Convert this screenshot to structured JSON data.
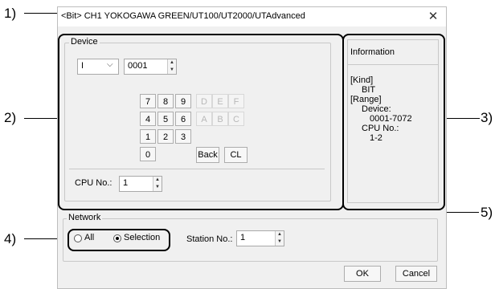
{
  "callouts": [
    "1)",
    "2)",
    "3)",
    "4)",
    "5)"
  ],
  "dialog": {
    "title": "<Bit> CH1 YOKOGAWA GREEN/UT100/UT2000/UTAdvanced",
    "close_glyph": "✕"
  },
  "device": {
    "group_label": "Device",
    "type_selected": "I",
    "number_value": "0001",
    "keypad": [
      {
        "label": "7",
        "enabled": true
      },
      {
        "label": "8",
        "enabled": true
      },
      {
        "label": "9",
        "enabled": true
      },
      {
        "label": "D",
        "enabled": false
      },
      {
        "label": "E",
        "enabled": false
      },
      {
        "label": "F",
        "enabled": false
      },
      {
        "label": "4",
        "enabled": true
      },
      {
        "label": "5",
        "enabled": true
      },
      {
        "label": "6",
        "enabled": true
      },
      {
        "label": "A",
        "enabled": false
      },
      {
        "label": "B",
        "enabled": false
      },
      {
        "label": "C",
        "enabled": false
      },
      {
        "label": "1",
        "enabled": true
      },
      {
        "label": "2",
        "enabled": true
      },
      {
        "label": "3",
        "enabled": true
      },
      {
        "label": "0",
        "enabled": true
      }
    ],
    "back_label": "Back",
    "clear_label": "CL",
    "cpu_label": "CPU No.:",
    "cpu_value": "1"
  },
  "information": {
    "header": "Information",
    "lines": [
      "[Kind]",
      "BIT",
      "[Range]",
      "Device:",
      "0001-7072",
      "CPU No.:",
      "1-2"
    ]
  },
  "network": {
    "group_label": "Network",
    "options": [
      {
        "label": "All",
        "selected": false
      },
      {
        "label": "Selection",
        "selected": true
      }
    ],
    "station_label": "Station No.:",
    "station_value": "1"
  },
  "buttons": {
    "ok": "OK",
    "cancel": "Cancel"
  }
}
